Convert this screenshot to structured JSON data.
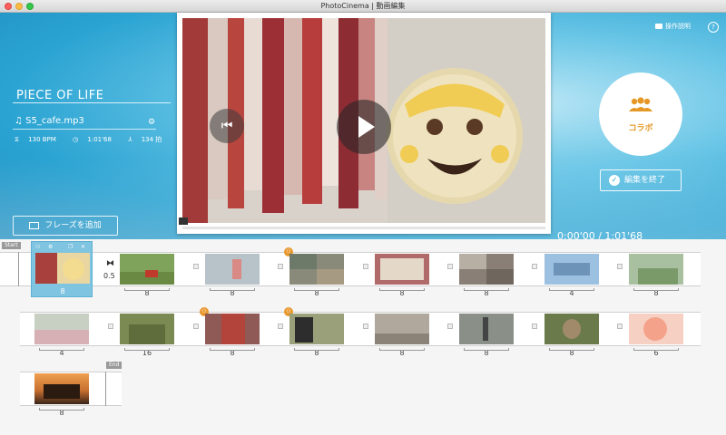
{
  "window": {
    "title": "PhotoCinema | 動画編集"
  },
  "header": {
    "manual_label": "操作説明",
    "help_label": "?"
  },
  "project": {
    "title": "PIECE OF LIFE",
    "music_file": "S5_cafe.mp3",
    "bpm": "130 BPM",
    "duration": "1:01'68",
    "beats": "134 拍"
  },
  "add_frame_label": "フレーズを追加",
  "collab_label": "コラボ",
  "finish_label": "編集を終了",
  "timecode": "0:00'00 / 1:01'68",
  "timeline": {
    "start_tag": "Start",
    "end_tag": "End",
    "rows": [
      {
        "items": [
          {
            "value": "8",
            "selected": true,
            "color": "#c98a6a",
            "badge": false
          },
          {
            "value": "8",
            "color": "#7fa35a",
            "badge": false
          },
          {
            "value": "8",
            "color": "#b8c2c9",
            "badge": false
          },
          {
            "value": "8",
            "color": "#8a8a7a",
            "badge": true
          },
          {
            "value": "8",
            "color": "#b06a6a",
            "badge": false
          },
          {
            "value": "8",
            "color": "#8a7f76",
            "badge": false
          },
          {
            "value": "4",
            "color": "#6d93b8",
            "badge": false
          },
          {
            "value": "8",
            "color": "#7a9a6a",
            "badge": false
          }
        ]
      },
      {
        "items": [
          {
            "value": "4",
            "color": "#c8d0c4",
            "badge": false
          },
          {
            "value": "16",
            "color": "#7a8a52",
            "badge": false
          },
          {
            "value": "8",
            "color": "#8f5a55",
            "badge": true
          },
          {
            "value": "8",
            "color": "#9aa07a",
            "badge": true
          },
          {
            "value": "8",
            "color": "#b0a89c",
            "badge": false
          },
          {
            "value": "8",
            "color": "#8a8f88",
            "badge": false
          },
          {
            "value": "8",
            "color": "#6a7a4a",
            "badge": false
          },
          {
            "value": "6",
            "color": "#f4a28a",
            "badge": false
          }
        ]
      },
      {
        "items": [
          {
            "value": "8",
            "color": "#c87030",
            "badge": false
          }
        ]
      }
    ],
    "transition_value": "0.5"
  }
}
